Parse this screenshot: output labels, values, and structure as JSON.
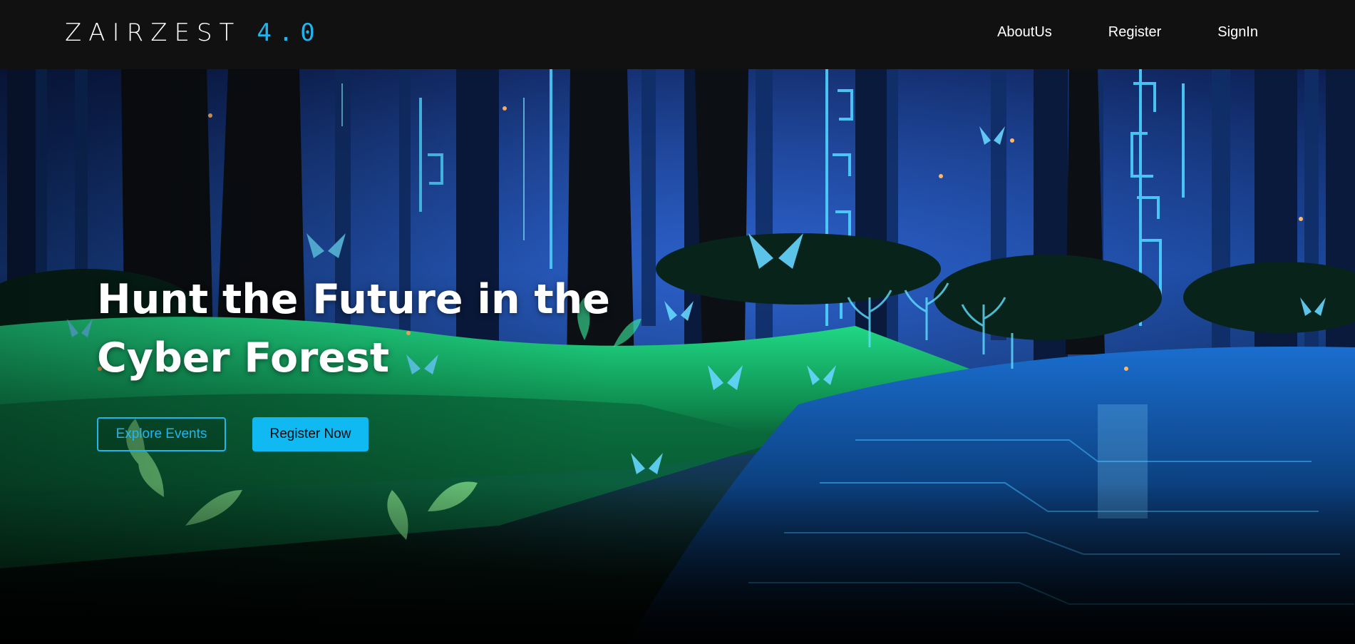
{
  "brand": {
    "name": "ZAIRZEST",
    "version": "4.0",
    "accent_color": "#1fb6f0"
  },
  "nav": {
    "links": [
      {
        "label": "AboutUs"
      },
      {
        "label": "Register"
      },
      {
        "label": "SignIn"
      }
    ]
  },
  "hero": {
    "title": "Hunt the Future in the Cyber Forest",
    "explore_button": "Explore Events",
    "register_button": "Register Now",
    "background": "night cyber forest with glowing butterflies and circuit-patterned trees"
  }
}
